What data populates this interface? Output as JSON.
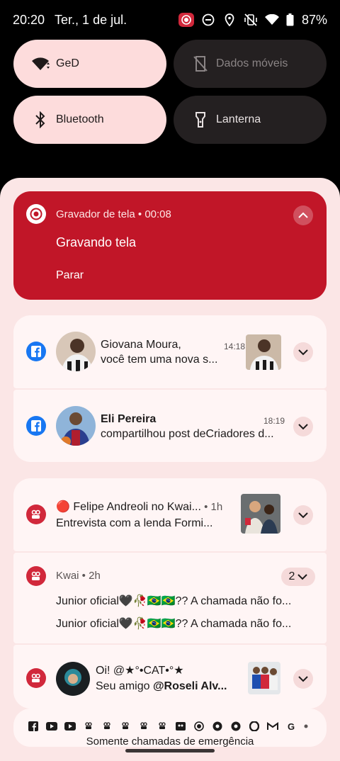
{
  "status": {
    "time": "20:20",
    "date": "Ter., 1 de jul.",
    "battery": "87%"
  },
  "tiles": [
    {
      "label": "GeD",
      "icon": "wifi-icon",
      "active": true
    },
    {
      "label": "Dados móveis",
      "icon": "mobile-data-off-icon",
      "active": false
    },
    {
      "label": "Bluetooth",
      "icon": "bluetooth-icon",
      "active": true
    },
    {
      "label": "Lanterna",
      "icon": "flashlight-icon",
      "active": false
    }
  ],
  "recorder": {
    "app": "Gravador de tela",
    "elapsed": "00:08",
    "title": "Gravando tela",
    "action": "Parar",
    "accent": "#c11628"
  },
  "notifications": [
    {
      "app": "facebook",
      "title": "Giovana Moura,",
      "text": "você tem uma nova s...",
      "time": "14:18"
    },
    {
      "app": "facebook",
      "title": "Eli Pereira",
      "text": "compartilhou post deCriadores d...",
      "time": "18:19"
    },
    {
      "app": "kwai",
      "title": "🔴 Felipe Andreoli no Kwai...",
      "time": "1h",
      "text": "Entrevista com a lenda Formi..."
    },
    {
      "app": "kwai",
      "header": "Kwai",
      "time": "2h",
      "count": "2",
      "lines": [
        "Junior   oficial🖤🥀🇧🇷🇧🇷?? A chamada não fo...",
        "Junior   oficial🖤🥀🇧🇷🇧🇷?? A chamada não fo..."
      ]
    },
    {
      "app": "kwai",
      "title": "Oi! @★°•CAT•°★",
      "text_prefix": "Seu amigo ",
      "text_bold": "@Roseli Alv..."
    }
  ],
  "footer": {
    "emergency": "Somente chamadas de emergência"
  },
  "colors": {
    "tile_on": "#fddcdc",
    "tile_off": "#242021",
    "shade": "#fbe6e6",
    "facebook": "#1877f2",
    "kwai": "#d1283b"
  }
}
